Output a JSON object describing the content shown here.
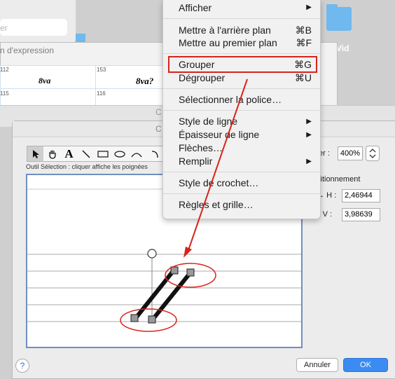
{
  "background": {
    "search_placeholder": "er",
    "folder_label": "Vid",
    "palette_title": "n d'expression",
    "cells": [
      "112",
      "153",
      "115",
      "116"
    ],
    "symbols": [
      "8va",
      "8va?"
    ],
    "window_title": "C"
  },
  "dialog": {
    "title": "C",
    "tool_hint": "Outil Sélection : cliquer affiche les poignées",
    "tools": [
      "select-arrow-icon",
      "hand-icon",
      "text-icon",
      "line-icon",
      "rectangle-icon",
      "ellipse-icon",
      "arc-icon",
      "bracket-icon"
    ],
    "zoom_label": "er :",
    "zoom_value": "400%",
    "position_title": "sitionnement",
    "h_label": "H :",
    "h_value": "2,46944",
    "v_label": "V :",
    "v_value": "3,98639",
    "help_label": "?",
    "cancel_label": "Annuler",
    "ok_label": "OK"
  },
  "menu": {
    "items": [
      {
        "label": "Afficher",
        "shortcut": "▶"
      },
      {
        "label": "Mettre à l'arrière plan",
        "shortcut": "⌘B"
      },
      {
        "label": "Mettre au premier plan",
        "shortcut": "⌘F"
      },
      {
        "label": "Grouper",
        "shortcut": "⌘G"
      },
      {
        "label": "Dégrouper",
        "shortcut": "⌘U"
      },
      {
        "label": "Sélectionner la police…",
        "shortcut": ""
      },
      {
        "label": "Style de ligne",
        "shortcut": "▶"
      },
      {
        "label": "Épaisseur de ligne",
        "shortcut": "▶"
      },
      {
        "label": "Flèches…",
        "shortcut": ""
      },
      {
        "label": "Remplir",
        "shortcut": "▶"
      },
      {
        "label": "Style de crochet…",
        "shortcut": ""
      },
      {
        "label": "Règles et grille…",
        "shortcut": ""
      }
    ]
  },
  "colors": {
    "annotation": "#d9231a",
    "accent": "#3b8cf2"
  }
}
